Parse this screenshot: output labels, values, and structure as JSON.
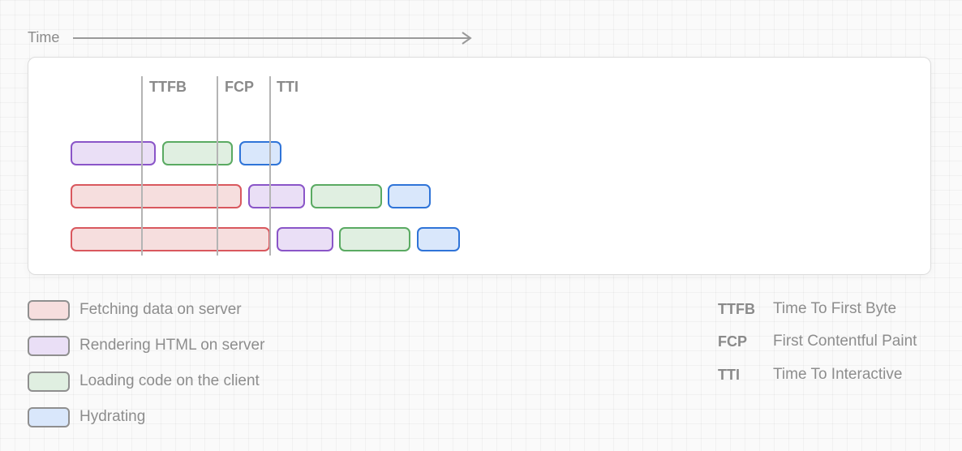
{
  "header": {
    "time_label": "Time"
  },
  "markers": [
    {
      "abbr": "TTFB"
    },
    {
      "abbr": "FCP"
    },
    {
      "abbr": "TTI"
    }
  ],
  "legend": [
    {
      "key": "fetch",
      "label": "Fetching data on server",
      "color": "#d9585e",
      "fill": "#f6dede"
    },
    {
      "key": "render",
      "label": "Rendering HTML on server",
      "color": "#8a55c8",
      "fill": "#eadff6"
    },
    {
      "key": "load",
      "label": "Loading code on the client",
      "color": "#5aaa62",
      "fill": "#e0efe1"
    },
    {
      "key": "hydrate",
      "label": "Hydrating",
      "color": "#2f74d8",
      "fill": "#d9e7fb"
    }
  ],
  "glossary": [
    {
      "abbr": "TTFB",
      "definition": "Time To First Byte"
    },
    {
      "abbr": "FCP",
      "definition": "First Contentful Paint"
    },
    {
      "abbr": "TTI",
      "definition": "Time To Interactive"
    }
  ]
}
